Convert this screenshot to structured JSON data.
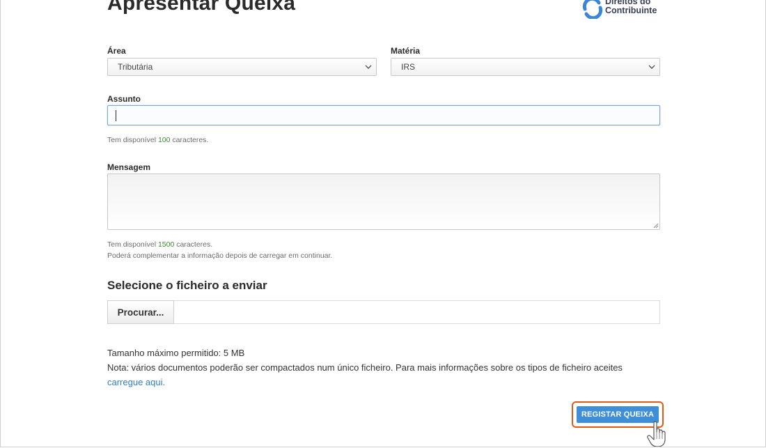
{
  "page": {
    "title": "Apresentar Queixa"
  },
  "logo": {
    "line1": "Direitos do",
    "line2": "Contribuinte"
  },
  "form": {
    "area": {
      "label": "Área",
      "value": "Tributária"
    },
    "materia": {
      "label": "Matéria",
      "value": "IRS"
    },
    "assunto": {
      "label": "Assunto",
      "value": "",
      "hint_prefix": "Tem disponível ",
      "hint_count": "100",
      "hint_suffix": " caracteres."
    },
    "mensagem": {
      "label": "Mensagem",
      "value": "",
      "hint_prefix": "Tem disponível ",
      "hint_count": "1500",
      "hint_suffix": " caracteres.",
      "hint_note": "Poderá complementar a informação depois de carregar em continuar."
    },
    "file": {
      "section_title": "Selecione o ficheiro a enviar",
      "browse_label": "Procurar..."
    },
    "info": {
      "max_size": "Tamanho máximo permitido: 5 MB",
      "note": "Nota: vários documentos poderão ser compactados num único ficheiro. Para mais informações sobre os tipos de ficheiro aceites ",
      "link": "carregue aqui."
    },
    "submit_label": "REGISTAR QUEIXA"
  },
  "icons": {
    "logo": "swirl-logo-icon",
    "select_chevron": "chevron-down-icon",
    "resize": "resize-handle-icon",
    "cursor": "hand-pointer-icon"
  },
  "colors": {
    "accent": "#3f8fd8",
    "highlight": "#e35b12",
    "link": "#2f7fc4",
    "count": "#3d8b2f"
  }
}
